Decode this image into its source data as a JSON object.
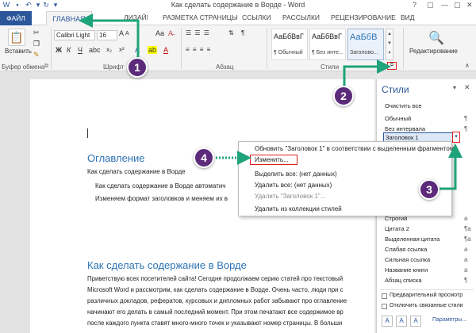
{
  "window": {
    "title": "Как сделать содержание в Ворде - Word",
    "controls": [
      "?",
      "▢",
      "—",
      "▢",
      "✕"
    ]
  },
  "tabs": {
    "file": "ФАЙЛ",
    "home": "ГЛАВНАЯ",
    "design": "ДИЗАЙН",
    "layout": "РАЗМЕТКА СТРАНИЦЫ",
    "references": "ССЫЛКИ",
    "mailings": "РАССЫЛКИ",
    "review": "РЕЦЕНЗИРОВАНИЕ",
    "view": "ВИД"
  },
  "ribbon": {
    "paste_label": "Вставить",
    "clipboard_label": "Буфер обмена",
    "font_name": "Calibri Light",
    "font_size": "16",
    "font_group_label": "Шрифт",
    "paragraph_label": "Абзац",
    "styles_label": "Стили",
    "editing_label": "Редактирование",
    "bold": "Ж",
    "italic": "К",
    "underline": "Ч",
    "grow_font": "A",
    "format_a": "Aa",
    "style_cards": [
      {
        "sample": "АаБбВвГ",
        "name": "¶ Обычный"
      },
      {
        "sample": "АаБбВвГ",
        "name": "¶ Без инте..."
      },
      {
        "sample": "АаБбВ",
        "name": "Заголово..."
      }
    ]
  },
  "document": {
    "toc_heading": "Оглавление",
    "toc_lines": [
      "Как сделать содержание в Ворде",
      "Как сделать содержание в Ворде автоматич",
      "Изменяем формат заголовков и меняем их в"
    ],
    "heading": "Как сделать содержание в Ворде",
    "body_lines": [
      "Приветствую всех посетителей сайта! Сегодня продолжаем серию статей про текстовый",
      "Microsoft Word и рассмотрим, как сделать содержание в Ворде. Очень часто, люди при с",
      "различных докладов, рефератов, курсовых и дипломных работ забывают про оглавление",
      "начинают его делать в самый последний момент. При этом печатают все содержимое вр",
      "после каждого пункта ставят много-много точек и указывают номер страницы.  В больши"
    ]
  },
  "styles_pane": {
    "title": "Стили",
    "items": [
      {
        "label": "Очистить все",
        "mark": ""
      },
      {
        "label": "Обычный",
        "mark": "¶"
      },
      {
        "label": "Без интервала",
        "mark": "¶"
      },
      {
        "label": "Заголовок 1",
        "mark": "¶a"
      },
      {
        "label": "Строгий",
        "mark": "a"
      },
      {
        "label": "Цитата 2",
        "mark": "¶a"
      },
      {
        "label": "Выделенная цитата",
        "mark": "¶a"
      },
      {
        "label": "Слабая ссылка",
        "mark": "a"
      },
      {
        "label": "Сильная ссылка",
        "mark": "a"
      },
      {
        "label": "Название книги",
        "mark": "a"
      },
      {
        "label": "Абзац списка",
        "mark": "¶"
      }
    ],
    "preview_label": "Предварительный просмотр",
    "linked_label": "Отключить связанные стили",
    "params_label": "Параметры..."
  },
  "context_menu": {
    "items": [
      {
        "label": "Обновить \"Заголовок 1\" в соответствии с выделенным фрагментом",
        "disabled": false
      },
      {
        "label": "Изменить...",
        "disabled": false
      },
      {
        "label": "Выделить все: (нет данных)",
        "disabled": false
      },
      {
        "label": "Удалить все: (нет данных)",
        "disabled": false
      },
      {
        "label": "Удалить \"Заголовок 1\"...",
        "disabled": true
      },
      {
        "label": "Удалить из коллекции стилей",
        "disabled": false
      }
    ]
  },
  "badges": [
    "1",
    "2",
    "3",
    "4"
  ],
  "colors": {
    "word_blue": "#2b579a",
    "heading_blue": "#2e74b5",
    "annotation_green": "#1fa37a",
    "badge_purple": "#5b2a7a",
    "highlight_red": "#e02020"
  }
}
